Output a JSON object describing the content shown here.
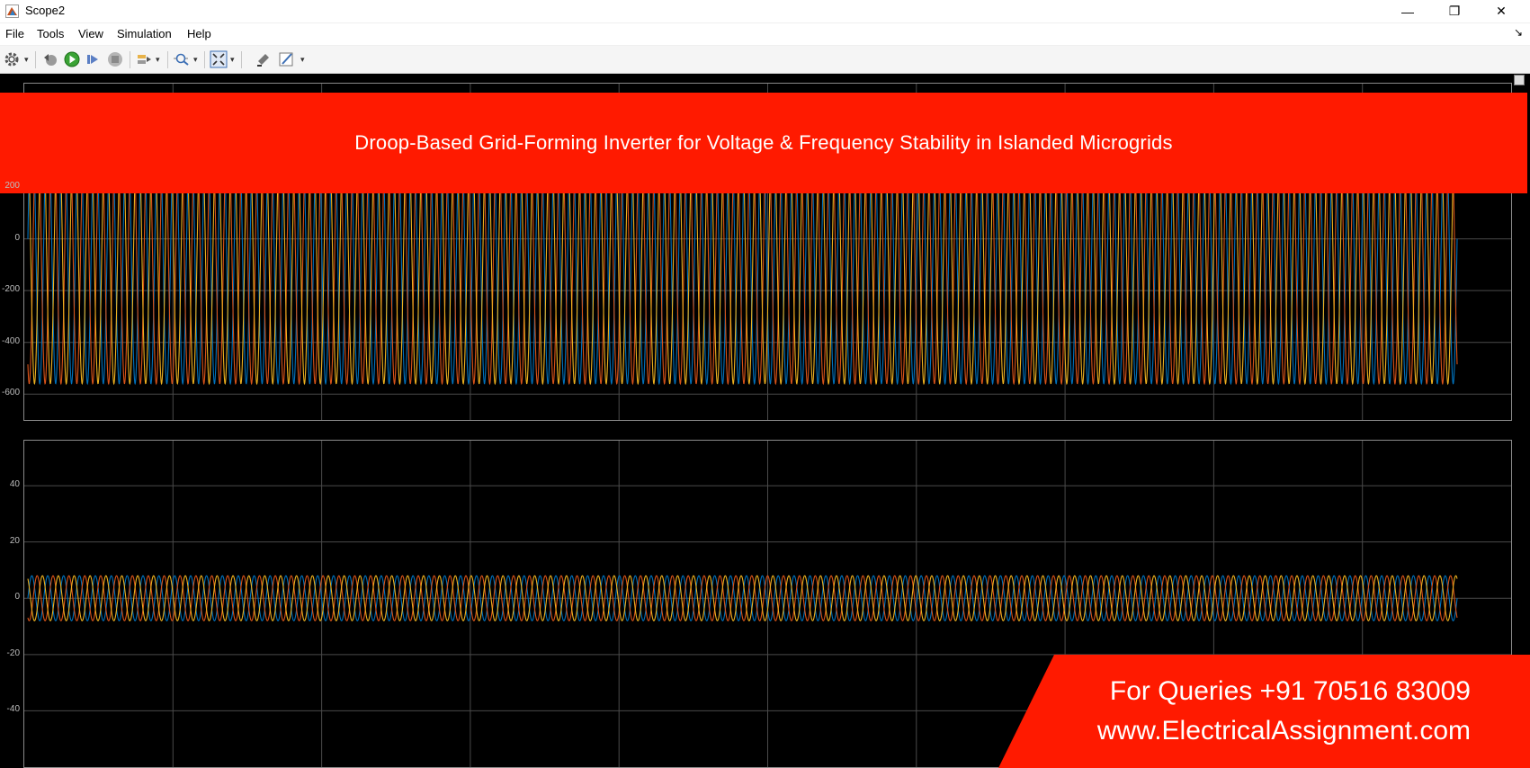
{
  "window": {
    "title": "Scope2",
    "minimize_glyph": "—",
    "restore_glyph": "❐",
    "close_glyph": "✕",
    "pin_glyph": "↘"
  },
  "menu": {
    "items": [
      "File",
      "Tools",
      "View",
      "Simulation",
      "Help"
    ]
  },
  "toolbar": {
    "icons": [
      "settings-gear-icon",
      "step-back-icon",
      "run-icon",
      "step-forward-icon",
      "stop-icon",
      "highlight-icon",
      "zoom-in-icon",
      "zoom-fit-icon",
      "restore-view-icon",
      "measure-icon"
    ]
  },
  "banner": {
    "text": "Droop-Based Grid-Forming Inverter for Voltage & Frequency Stability in Islanded Microgrids",
    "color": "#ff1a00"
  },
  "query": {
    "line1": "For Queries +91 70516 83009",
    "line2": "www.ElectricalAssignment.com"
  },
  "colors": {
    "series_a": "#0072bd",
    "series_b": "#d95319",
    "series_c": "#edb120",
    "background": "#000000",
    "grid": "#4a4a4a"
  },
  "chart_data": [
    {
      "type": "line",
      "name": "top-scope",
      "yticks": [
        200,
        0,
        -200,
        -400,
        -600
      ],
      "ytick_labels": [
        "200",
        "0",
        "-200",
        "-400",
        "-600"
      ],
      "ylim": [
        -700,
        600
      ],
      "series": [
        {
          "amplitude": 560,
          "phase_deg": 0,
          "color": "#0072bd"
        },
        {
          "amplitude": 560,
          "phase_deg": -120,
          "color": "#d95319"
        },
        {
          "amplitude": 560,
          "phase_deg": 120,
          "color": "#edb120"
        }
      ],
      "cycles": 90
    },
    {
      "type": "line",
      "name": "bottom-scope",
      "yticks": [
        40,
        20,
        0,
        -20,
        -40
      ],
      "ytick_labels": [
        "40",
        "20",
        "0",
        "-20",
        "-40"
      ],
      "ylim": [
        -60,
        56
      ],
      "series": [
        {
          "amplitude": 8,
          "phase_deg": 0,
          "color": "#0072bd"
        },
        {
          "amplitude": 8,
          "phase_deg": -120,
          "color": "#d95319"
        },
        {
          "amplitude": 8,
          "phase_deg": 120,
          "color": "#edb120"
        }
      ],
      "cycles": 90
    }
  ]
}
